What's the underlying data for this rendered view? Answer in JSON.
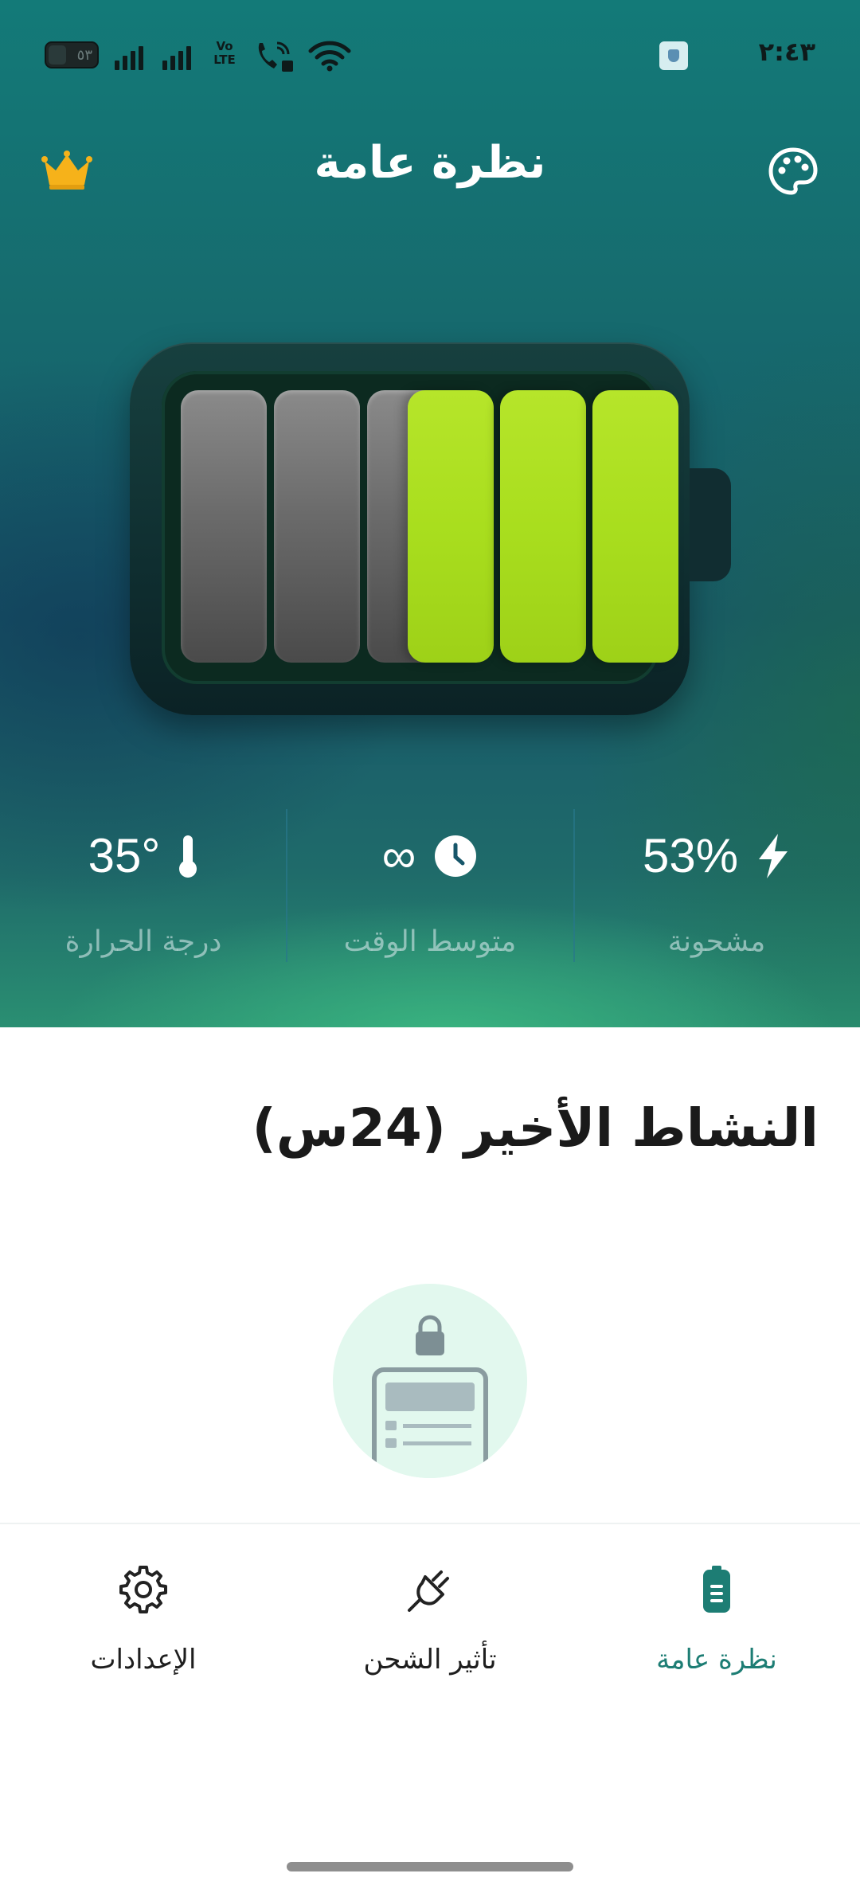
{
  "status_bar": {
    "time": "٢:٤٣",
    "battery_level": "٥٣",
    "network": "Vo LTE"
  },
  "header": {
    "title": "نظرة عامة",
    "premium_icon": "crown-icon",
    "theme_icon": "palette-icon"
  },
  "battery": {
    "level_percent": 53,
    "total_cells": 6,
    "charged_cells": 3
  },
  "stats": [
    {
      "value": "53%",
      "label": "مشحونة",
      "icon": "lightning-icon"
    },
    {
      "value": "∞",
      "label": "متوسط الوقت",
      "icon": "clock-icon"
    },
    {
      "value": "35°",
      "label": "درجة الحرارة",
      "icon": "thermometer-icon"
    }
  ],
  "recent_activity": {
    "title": "النشاط الأخير (24س)"
  },
  "nav": {
    "overview": "نظرة عامة",
    "charging": "تأثير الشحن",
    "settings": "الإعدادات"
  },
  "colors": {
    "accent": "#1d7d74",
    "charged_cell": "#a9de1e",
    "empty_cell": "#6b6b6b"
  }
}
